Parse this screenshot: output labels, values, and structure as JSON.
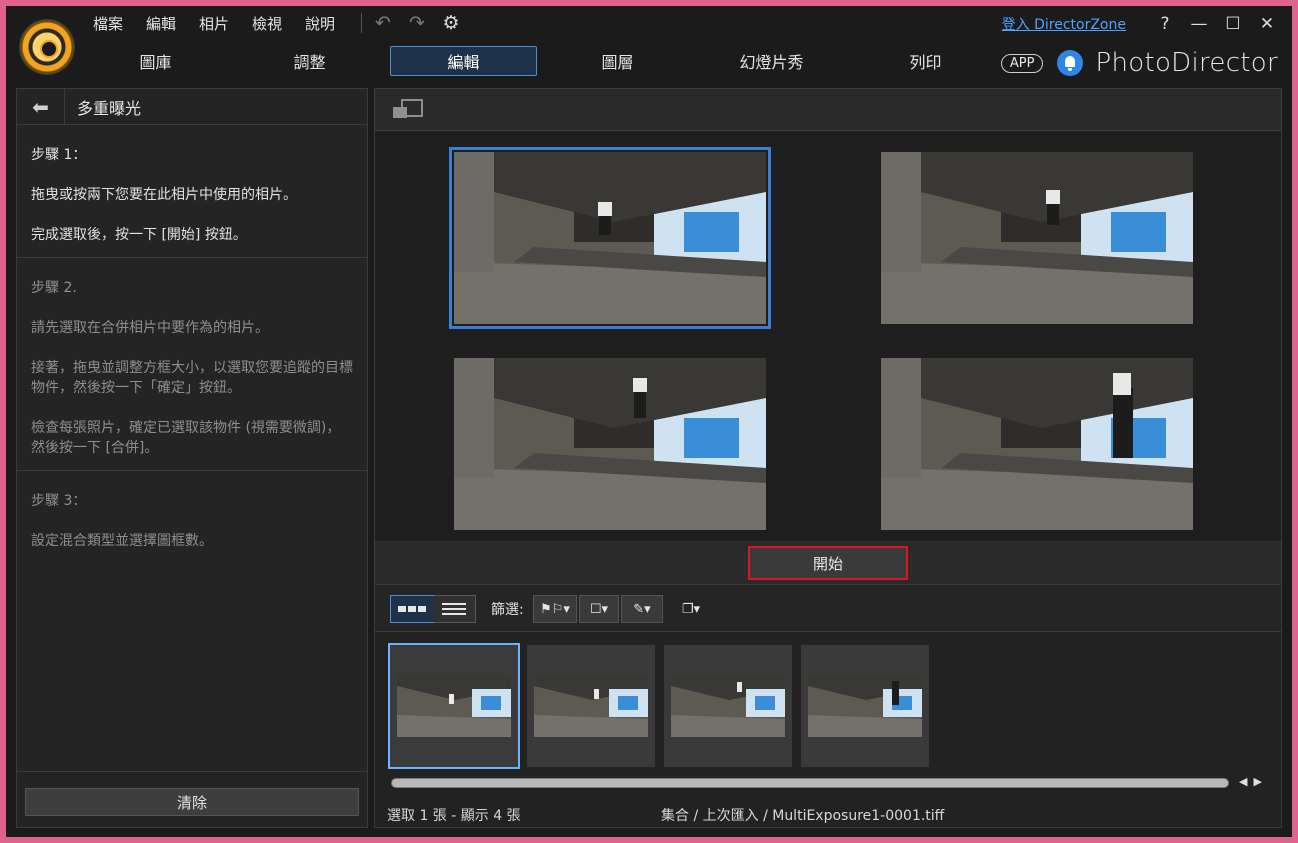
{
  "app": {
    "brand": "PhotoDirector",
    "app_badge": "APP",
    "login_link": "登入 DirectorZone",
    "help": "?"
  },
  "menu": [
    "檔案",
    "編輯",
    "相片",
    "檢視",
    "說明"
  ],
  "tabs": [
    "圖庫",
    "調整",
    "編輯",
    "圖層",
    "幻燈片秀",
    "列印"
  ],
  "active_tab": "編輯",
  "left_panel": {
    "title": "多重曝光",
    "steps": [
      {
        "heading": "步驟 1：",
        "lines": [
          "拖曳或按兩下您要在此相片中使用的相片。",
          "完成選取後，按一下 [開始] 按鈕。"
        ]
      },
      {
        "heading": "步驟 2.",
        "lines": [
          "請先選取在合併相片中要作為的相片。",
          "接著，拖曳並調整方框大小，以選取您要追蹤的目標物件，然後按一下「確定」按鈕。",
          "檢查每張照片，確定已選取該物件 (視需要微調)，然後按一下 [合併]。"
        ]
      },
      {
        "heading": "步驟 3：",
        "lines": [
          "設定混合類型並選擇圖框數。"
        ]
      }
    ],
    "clear_button": "清除"
  },
  "main": {
    "start_button": "開始",
    "filter_label": "篩選:",
    "status_selection": "選取 1 張 - 顯示 4 張",
    "status_path": "集合 / 上次匯入 / MultiExposure1-0001.tiff"
  }
}
